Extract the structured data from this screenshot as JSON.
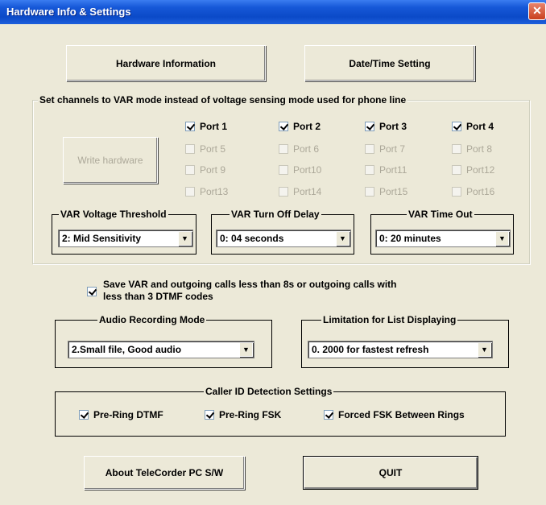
{
  "window": {
    "title": "Hardware Info & Settings",
    "close_glyph": "✕"
  },
  "buttons": {
    "hardware_information": "Hardware Information",
    "date_time_setting": "Date/Time Setting",
    "write_hardware": "Write hardware",
    "about": "About TeleCorder PC S/W",
    "quit": "QUIT"
  },
  "var_mode": {
    "title": "Set channels to VAR mode instead of voltage sensing mode used for phone line",
    "ports": [
      {
        "label": "Port 1",
        "checked": true,
        "enabled": true
      },
      {
        "label": "Port 2",
        "checked": true,
        "enabled": true
      },
      {
        "label": "Port 3",
        "checked": true,
        "enabled": true
      },
      {
        "label": "Port 4",
        "checked": true,
        "enabled": true
      },
      {
        "label": "Port 5",
        "checked": false,
        "enabled": false
      },
      {
        "label": "Port 6",
        "checked": false,
        "enabled": false
      },
      {
        "label": "Port 7",
        "checked": false,
        "enabled": false
      },
      {
        "label": "Port 8",
        "checked": false,
        "enabled": false
      },
      {
        "label": "Port 9",
        "checked": false,
        "enabled": false
      },
      {
        "label": "Port10",
        "checked": false,
        "enabled": false
      },
      {
        "label": "Port11",
        "checked": false,
        "enabled": false
      },
      {
        "label": "Port12",
        "checked": false,
        "enabled": false
      },
      {
        "label": "Port13",
        "checked": false,
        "enabled": false
      },
      {
        "label": "Port14",
        "checked": false,
        "enabled": false
      },
      {
        "label": "Port15",
        "checked": false,
        "enabled": false
      },
      {
        "label": "Port16",
        "checked": false,
        "enabled": false
      }
    ],
    "voltage_threshold": {
      "title": "VAR Voltage Threshold",
      "value": "2: Mid Sensitivity"
    },
    "turn_off_delay": {
      "title": "VAR Turn Off Delay",
      "value": "0: 04 seconds"
    },
    "time_out": {
      "title": "VAR Time Out",
      "value": "0: 20 minutes"
    }
  },
  "save_var": {
    "checked": true,
    "line1": "Save VAR and outgoing calls less than 8s or outgoing calls with",
    "line2": "less than 3 DTMF codes"
  },
  "audio_recording": {
    "title": "Audio Recording Mode",
    "value": "2.Small file, Good audio"
  },
  "list_limitation": {
    "title": "Limitation for List Displaying",
    "value": "0. 2000 for fastest refresh"
  },
  "caller_id": {
    "title": "Caller ID Detection Settings",
    "options": [
      {
        "label": "Pre-Ring DTMF",
        "checked": true
      },
      {
        "label": "Pre-Ring FSK",
        "checked": true
      },
      {
        "label": "Forced FSK Between Rings",
        "checked": true
      }
    ]
  },
  "colors": {
    "face": "#ece9d8",
    "title_blue": "#0b4ac8",
    "disabled_text": "#aca899"
  },
  "icons": {
    "dropdown": "▼",
    "check": "check-mark"
  }
}
